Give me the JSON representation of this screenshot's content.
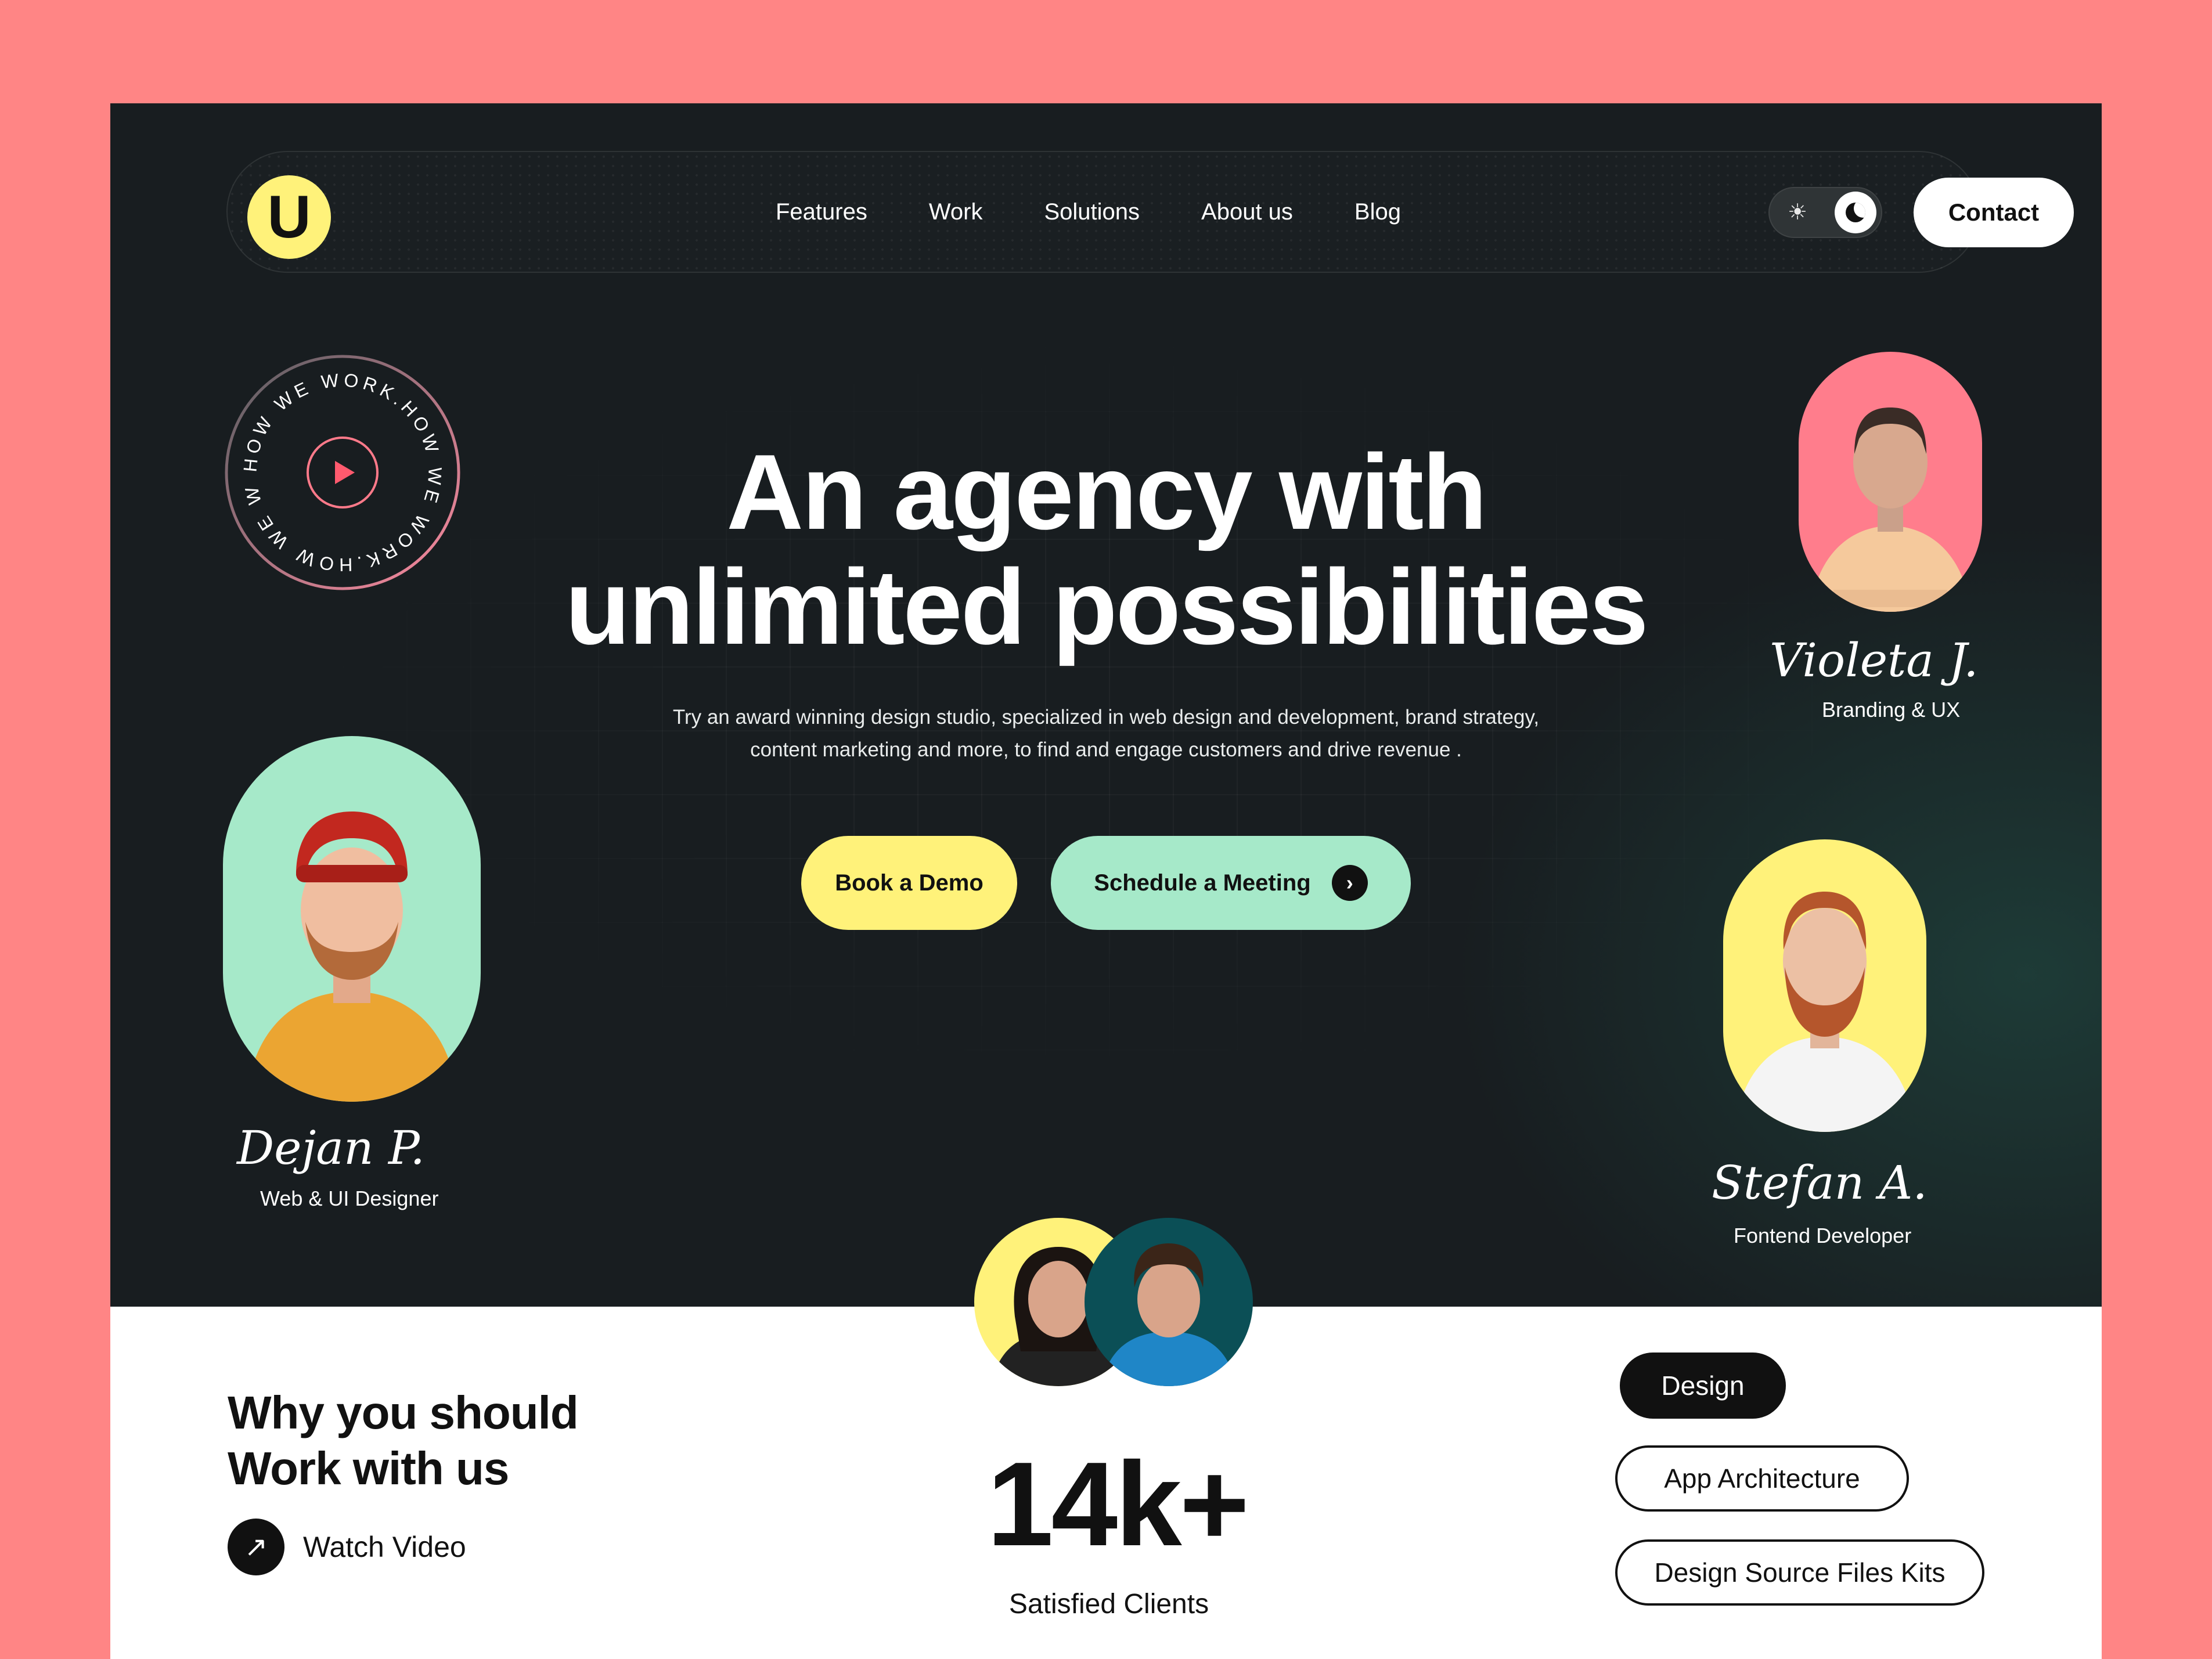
{
  "nav": {
    "logo_mark": "U",
    "links": [
      "Features",
      "Work",
      "Solutions",
      "About us",
      "Blog"
    ],
    "theme_toggle": {
      "sun_icon": "sun-icon",
      "moon_icon": "moon-icon",
      "mode": "dark"
    },
    "contact_label": "Contact"
  },
  "badge": {
    "ring_text": "HOW WE WORK.HOW WE WORK.HOW WE WORK.",
    "icon": "play-icon"
  },
  "hero": {
    "headline_line1": "An agency with",
    "headline_line2": "unlimited possibilities",
    "subtitle_line1": "Try an award winning  design studio, specialized in web design and development, brand strategy,",
    "subtitle_line2": "content marketing and more, to find and engage customers and drive revenue .",
    "primary_cta": "Book a Demo",
    "secondary_cta": "Schedule a Meeting",
    "secondary_cta_icon": "chevron-right-icon"
  },
  "team": [
    {
      "signature": "Dejan P.",
      "role": "Web & UI Designer",
      "bg": "#A6E9C9"
    },
    {
      "signature": "Violeta J.",
      "role": "Branding & UX",
      "bg": "#FF7D8C"
    },
    {
      "signature": "Stefan A.",
      "role": "Fontend Developer",
      "bg": "#FFF27A"
    }
  ],
  "why": {
    "title_line1": "Why you should",
    "title_line2": "Work with us",
    "watch_label": "Watch Video",
    "watch_icon": "arrow-up-right-icon"
  },
  "stats": {
    "number": "14k+",
    "label": "Satisfied Clients",
    "avatar_colors": [
      "#FFF27A",
      "#0B4F56"
    ]
  },
  "services": {
    "active": "Design",
    "items": [
      "Design",
      "App Architecture",
      "Design Source Files Kits"
    ]
  },
  "colors": {
    "page_bg": "#FF8585",
    "hero_bg": "#181D20",
    "yellow": "#FFF27A",
    "mint": "#A6E9C9",
    "pink": "#FF7D8C",
    "play": "#FF5A6E"
  }
}
